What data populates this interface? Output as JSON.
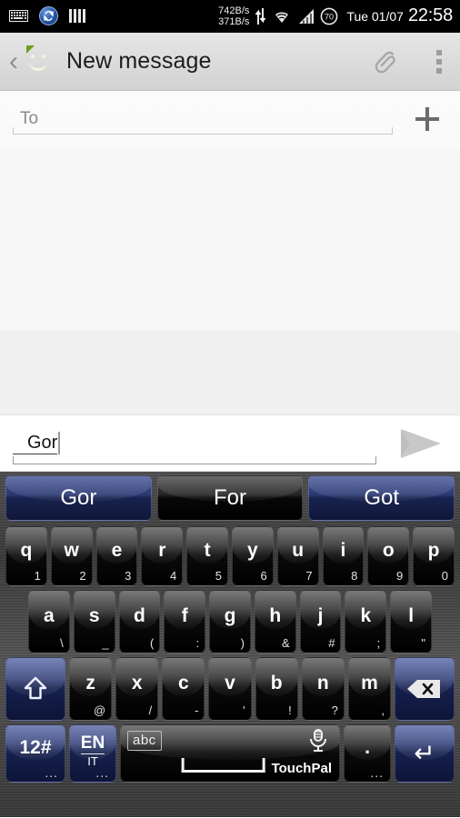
{
  "status_bar": {
    "icons": [
      "keyboard-icon",
      "sync-icon",
      "signal-bars-icon",
      "updown-arrows-icon",
      "wifi-icon",
      "cellular-icon",
      "battery-icon"
    ],
    "net_down": "742B/s",
    "net_up": "371B/s",
    "battery_level": "70",
    "date": "Tue 01/07",
    "time": "22:58"
  },
  "action_bar": {
    "back_label": "‹",
    "title": "New message",
    "attach_label": "attach",
    "overflow_label": "more options"
  },
  "recipient": {
    "placeholder": "To",
    "value": "",
    "add_contact_label": "+"
  },
  "compose": {
    "text": "Gor",
    "send_label": "Send"
  },
  "keyboard": {
    "suggestions": [
      {
        "label": "Gor",
        "style": "blue"
      },
      {
        "label": "For",
        "style": "dark"
      },
      {
        "label": "Got",
        "style": "blue"
      }
    ],
    "row1": [
      {
        "main": "q",
        "sub": "1"
      },
      {
        "main": "w",
        "sub": "2"
      },
      {
        "main": "e",
        "sub": "3"
      },
      {
        "main": "r",
        "sub": "4"
      },
      {
        "main": "t",
        "sub": "5"
      },
      {
        "main": "y",
        "sub": "6"
      },
      {
        "main": "u",
        "sub": "7"
      },
      {
        "main": "i",
        "sub": "8"
      },
      {
        "main": "o",
        "sub": "9"
      },
      {
        "main": "p",
        "sub": "0"
      }
    ],
    "row2": [
      {
        "main": "a",
        "sub": "\\"
      },
      {
        "main": "s",
        "sub": "_"
      },
      {
        "main": "d",
        "sub": "("
      },
      {
        "main": "f",
        "sub": ":"
      },
      {
        "main": "g",
        "sub": ")"
      },
      {
        "main": "h",
        "sub": "&"
      },
      {
        "main": "j",
        "sub": "#"
      },
      {
        "main": "k",
        "sub": ";"
      },
      {
        "main": "l",
        "sub": "\""
      }
    ],
    "row3": [
      {
        "main": "z",
        "sub": "@"
      },
      {
        "main": "x",
        "sub": "/"
      },
      {
        "main": "c",
        "sub": "-"
      },
      {
        "main": "v",
        "sub": "'"
      },
      {
        "main": "b",
        "sub": "!"
      },
      {
        "main": "n",
        "sub": "?"
      },
      {
        "main": "m",
        "sub": ","
      }
    ],
    "shift_label": "shift",
    "backspace_label": "backspace",
    "numsym_label": "12#",
    "numsym_more": "...",
    "lang_primary": "EN",
    "lang_secondary": "IT",
    "lang_more": "...",
    "space_mode_badge": "abc",
    "space_brand": "TouchPal",
    "space_mic_label": "voice input",
    "period_label": ".",
    "period_more": "...",
    "enter_label": "↵"
  },
  "colors": {
    "status_bg": "#000000",
    "action_bar_bg": "#dcdcdc",
    "app_icon_green": "#7fae2c",
    "key_blue": "#2e3c77",
    "key_black": "#0a0a0a",
    "body_bg": "#f7f7f7"
  }
}
